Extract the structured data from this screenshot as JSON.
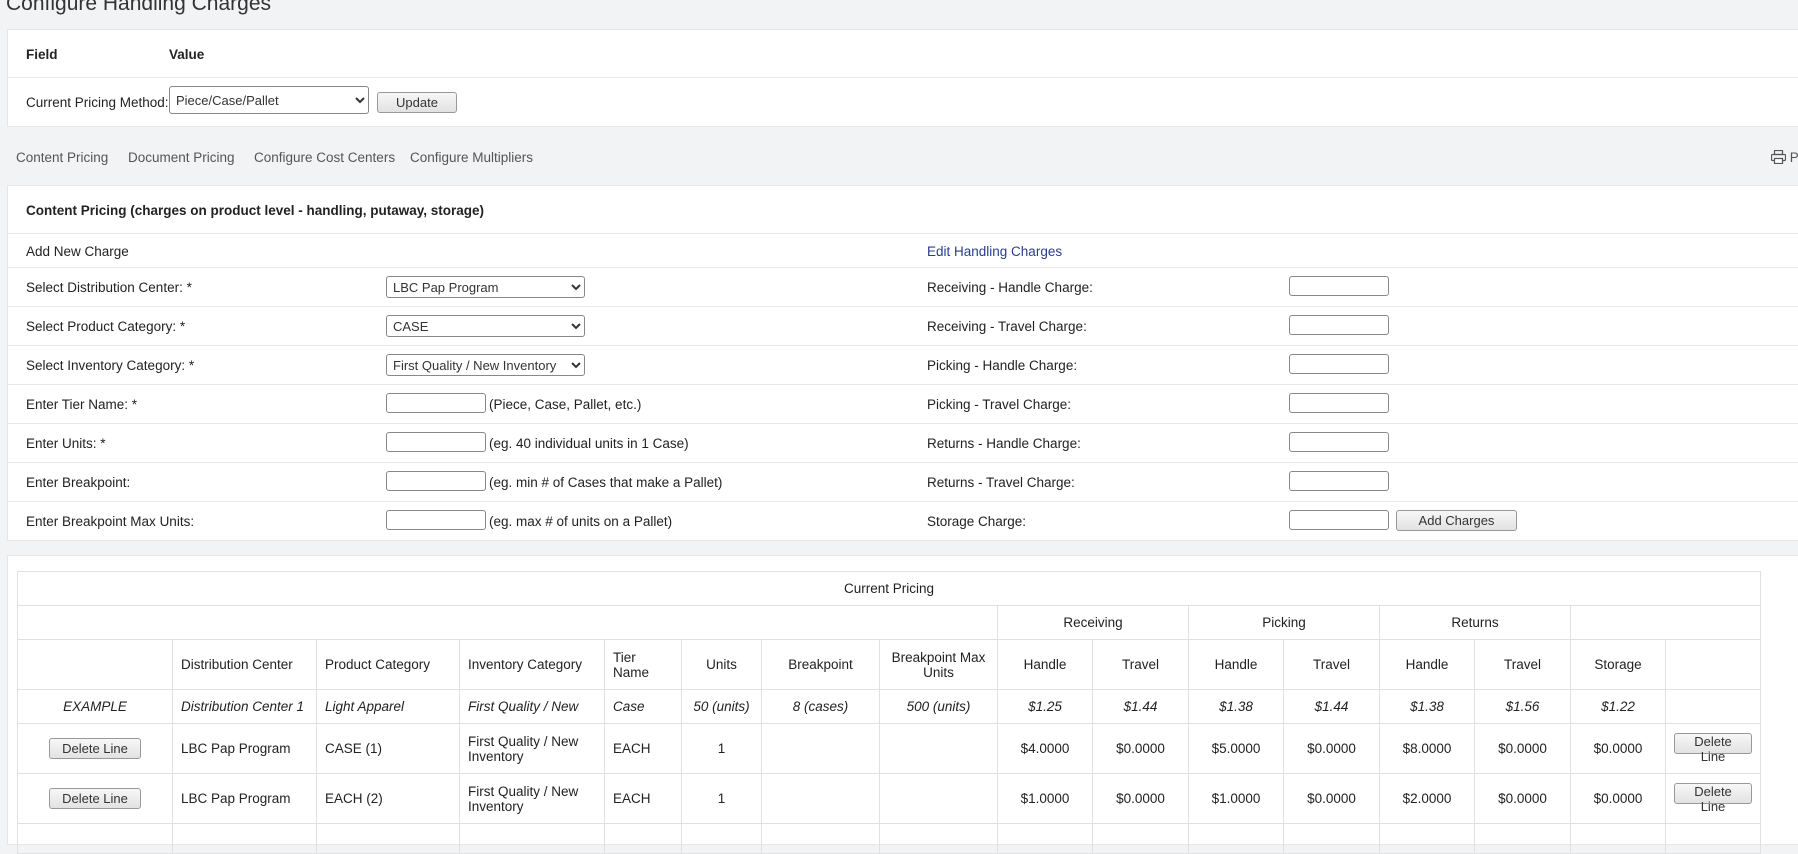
{
  "page": {
    "title": "Configure Handling Charges"
  },
  "method_card": {
    "field_header": "Field",
    "value_header": "Value",
    "pricing_label": "Current Pricing Method:",
    "pricing_value": "Piece/Case/Pallet",
    "update_label": "Update"
  },
  "tabs": [
    "Content Pricing",
    "Document Pricing",
    "Configure Cost Centers",
    "Configure Multipliers"
  ],
  "print_label": "P",
  "content_form": {
    "heading": "Content Pricing (charges on product level - handling, putaway, storage)",
    "add_new": "Add New Charge",
    "edit_link": "Edit Handling Charges",
    "left_fields": [
      {
        "label": "Select Distribution Center: *",
        "type": "select",
        "value": "LBC Pap Program",
        "hint": ""
      },
      {
        "label": "Select Product Category: *",
        "type": "select",
        "value": "CASE",
        "hint": ""
      },
      {
        "label": "Select Inventory Category: *",
        "type": "select",
        "value": "First Quality / New Inventory",
        "hint": ""
      },
      {
        "label": "Enter Tier Name: *",
        "type": "input",
        "value": "",
        "hint": "(Piece, Case, Pallet, etc.)"
      },
      {
        "label": "Enter Units: *",
        "type": "input",
        "value": "",
        "hint": "(eg. 40 individual units in 1 Case)"
      },
      {
        "label": "Enter Breakpoint:",
        "type": "input",
        "value": "",
        "hint": "(eg. min # of Cases that make a Pallet)"
      },
      {
        "label": "Enter Breakpoint Max Units:",
        "type": "input",
        "value": "",
        "hint": "(eg. max # of units on a Pallet)"
      }
    ],
    "right_fields": [
      "Receiving - Handle Charge:",
      "Receiving - Travel Charge:",
      "Picking - Handle Charge:",
      "Picking - Travel Charge:",
      "Returns - Handle Charge:",
      "Returns - Travel Charge:",
      "Storage Charge:"
    ],
    "add_charges_label": "Add Charges"
  },
  "current_pricing": {
    "title": "Current Pricing",
    "groups": [
      "Receiving",
      "Picking",
      "Returns"
    ],
    "headers": [
      "Distribution Center",
      "Product Category",
      "Inventory Category",
      "Tier Name",
      "Units",
      "Breakpoint",
      "Breakpoint Max Units",
      "Handle",
      "Travel",
      "Handle",
      "Travel",
      "Handle",
      "Travel",
      "Storage"
    ],
    "example": {
      "label": "EXAMPLE",
      "cells": [
        "Distribution Center 1",
        "Light Apparel",
        "First Quality / New",
        "Case",
        "50 (units)",
        "8 (cases)",
        "500 (units)",
        "$1.25",
        "$1.44",
        "$1.38",
        "$1.44",
        "$1.38",
        "$1.56",
        "$1.22"
      ]
    },
    "delete_label": "Delete Line",
    "rows": [
      {
        "cells": [
          "LBC Pap Program",
          "CASE (1)",
          "First Quality / New Inventory",
          "EACH",
          "1",
          "",
          "",
          "$4.0000",
          "$0.0000",
          "$5.0000",
          "$0.0000",
          "$8.0000",
          "$0.0000",
          "$0.0000"
        ]
      },
      {
        "cells": [
          "LBC Pap Program",
          "EACH (2)",
          "First Quality / New Inventory",
          "EACH",
          "1",
          "",
          "",
          "$1.0000",
          "$0.0000",
          "$1.0000",
          "$0.0000",
          "$2.0000",
          "$0.0000",
          "$0.0000"
        ]
      }
    ]
  }
}
